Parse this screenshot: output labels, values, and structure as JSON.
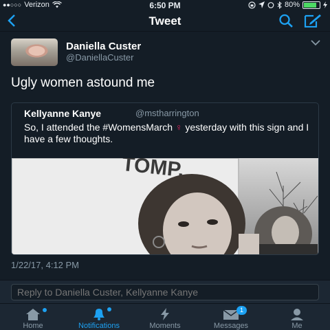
{
  "status_bar": {
    "carrier": "Verizon",
    "signal_dots": "●●○○○",
    "time": "6:50 PM",
    "battery": "80%",
    "battery_level": 0.8
  },
  "nav": {
    "title": "Tweet",
    "back_icon": "chevron-left-icon",
    "search_icon": "search-icon",
    "compose_icon": "compose-icon"
  },
  "tweet": {
    "author_name": "Daniella Custer",
    "author_handle": "@DaniellaCuster",
    "text": "Ugly women astound me",
    "timestamp": "1/22/17, 4:12 PM"
  },
  "quoted": {
    "author_name": "Kellyanne Kanye",
    "author_handle": "@mstharrington",
    "text": "So, I attended the #WomensMarch",
    "emoji": "♀",
    "text_after": "yesterday with this sign and I have a few thoughts.",
    "sign_text": "TOMP."
  },
  "reply": {
    "placeholder": "Reply to Daniella Custer, Kellyanne Kanye"
  },
  "tabs": [
    {
      "label": "Home",
      "icon": "home-icon"
    },
    {
      "label": "Notifications",
      "icon": "bell-icon"
    },
    {
      "label": "Moments",
      "icon": "lightning-icon"
    },
    {
      "label": "Messages",
      "icon": "envelope-icon",
      "badge": "1"
    },
    {
      "label": "Me",
      "icon": "person-icon"
    }
  ],
  "colors": {
    "accent": "#1da1f2",
    "background": "#141d26",
    "secondary_text": "#8899a6"
  }
}
